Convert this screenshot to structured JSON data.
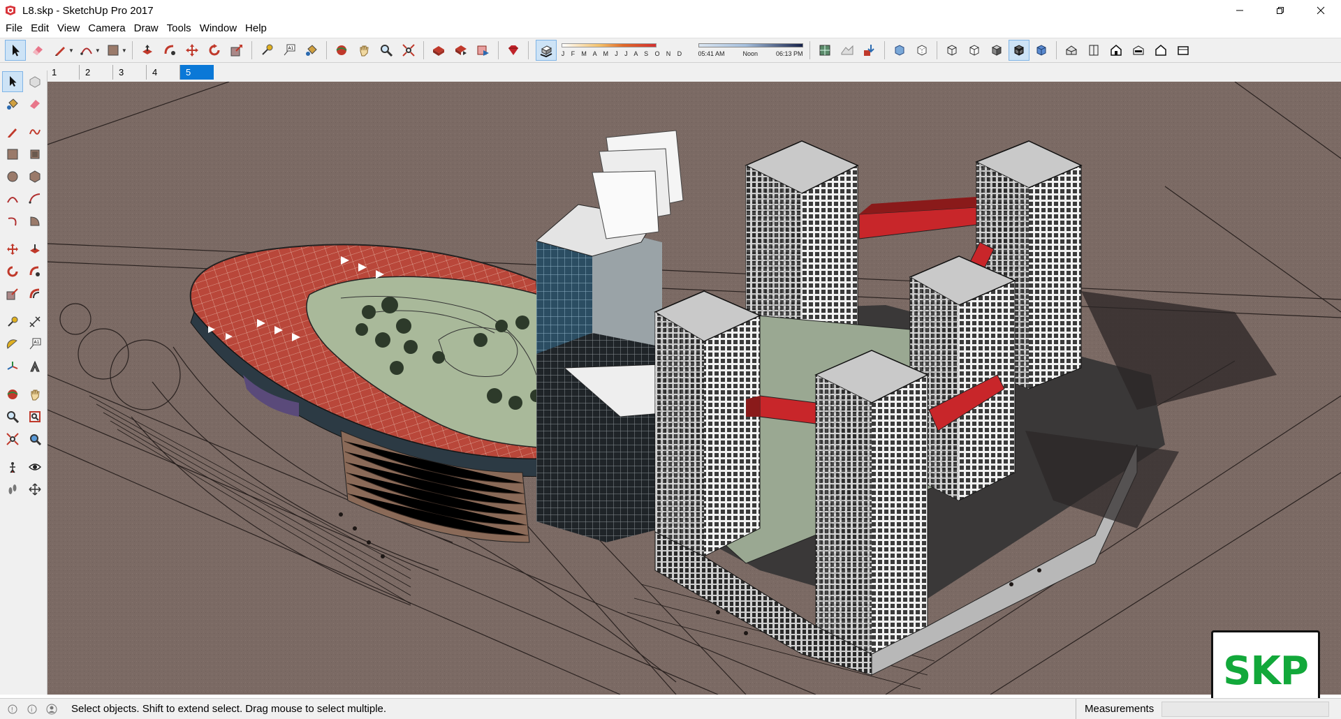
{
  "window": {
    "title": "L8.skp - SketchUp Pro 2017",
    "controls": [
      "minimize",
      "restore",
      "close"
    ]
  },
  "menu": [
    "File",
    "Edit",
    "View",
    "Camera",
    "Draw",
    "Tools",
    "Window",
    "Help"
  ],
  "toolbar": {
    "shadow_months": "J F M A M J J A S O N D",
    "time_start": "05:41 AM",
    "time_mid": "Noon",
    "time_end": "06:13 PM"
  },
  "scenes": [
    {
      "label": "1",
      "active": false
    },
    {
      "label": "2",
      "active": false
    },
    {
      "label": "3",
      "active": false
    },
    {
      "label": "4",
      "active": false
    },
    {
      "label": "5",
      "active": true
    }
  ],
  "logo": {
    "text": "SKP"
  },
  "status": {
    "hint": "Select objects. Shift to extend select. Drag mouse to select multiple.",
    "measurements_label": "Measurements",
    "measurements_value": ""
  },
  "colors": {
    "ground": "#7b6a64",
    "roof_red": "#b94a3a",
    "bridge_red": "#c8262a",
    "tower_white": "#e6e6e6",
    "garden_green": "#a9b99a",
    "selection_blue": "#0a78d7",
    "logo_green": "#12a83a"
  }
}
